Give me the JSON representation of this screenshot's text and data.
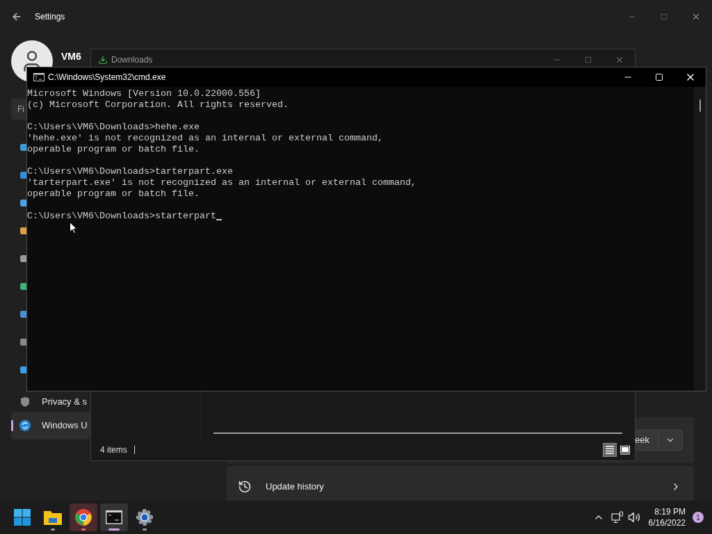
{
  "settings": {
    "title": "Settings",
    "user": {
      "name": "VM6"
    },
    "search": {
      "placeholder": "Fi"
    },
    "nav_items": [
      {
        "selected": false
      },
      {
        "selected": false
      },
      {
        "selected": false
      },
      {
        "selected": false
      },
      {
        "selected": false
      },
      {
        "selected": false
      },
      {
        "selected": false
      },
      {
        "selected": false
      },
      {
        "selected": false
      },
      {
        "label": "Privacy & s",
        "selected": false
      },
      {
        "label": "Windows U",
        "selected": true
      }
    ],
    "pause_card": {
      "button": "eek"
    },
    "update_history": {
      "label": "Update history"
    }
  },
  "downloads": {
    "title": "Downloads",
    "status": "4 items",
    "views": [
      {
        "selected": true
      },
      {
        "selected": false
      }
    ]
  },
  "cmd": {
    "title": "C:\\Windows\\System32\\cmd.exe",
    "blocks": [
      [
        "Microsoft Windows [Version 10.0.22000.556]",
        "(c) Microsoft Corporation. All rights reserved."
      ],
      [
        "C:\\Users\\VM6\\Downloads>hehe.exe",
        "'hehe.exe' is not recognized as an internal or external command,",
        "operable program or batch file."
      ],
      [
        "C:\\Users\\VM6\\Downloads>tarterpart.exe",
        "'tarterpart.exe' is not recognized as an internal or external command,",
        "operable program or batch file."
      ],
      [
        "C:\\Users\\VM6\\Downloads>starterpart"
      ]
    ]
  },
  "taskbar": {
    "apps": [
      {
        "kind": "start",
        "running": false,
        "selected": false,
        "attention": false
      },
      {
        "kind": "explorer",
        "running": true,
        "selected": false,
        "attention": false
      },
      {
        "kind": "chrome",
        "running": true,
        "selected": false,
        "attention": true
      },
      {
        "kind": "terminal",
        "running": true,
        "selected": true,
        "attention": false
      },
      {
        "kind": "settings",
        "running": true,
        "selected": false,
        "attention": false
      }
    ],
    "time": "8:19 PM",
    "date": "6/16/2022",
    "notifications": "1"
  }
}
